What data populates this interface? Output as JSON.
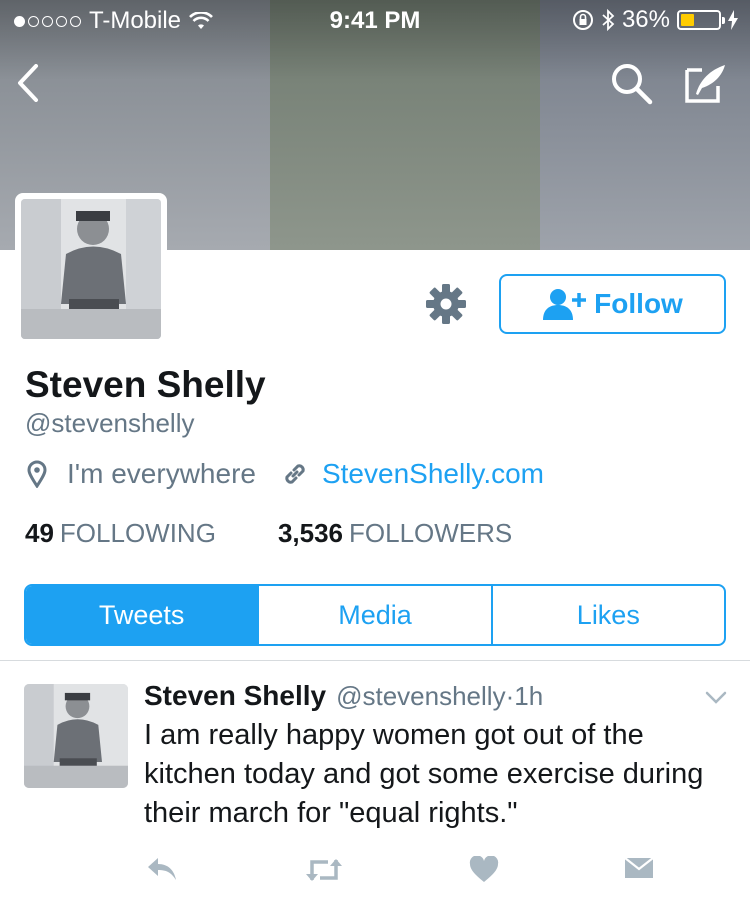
{
  "status_bar": {
    "carrier": "T-Mobile",
    "time": "9:41 PM",
    "battery": "36%",
    "battery_level": 0.36
  },
  "profile": {
    "name": "Steven Shelly",
    "handle": "@stevenshelly",
    "location": "I'm everywhere",
    "url": "StevenShelly.com",
    "following_count": "49",
    "following_label": "FOLLOWING",
    "followers_count": "3,536",
    "followers_label": "FOLLOWERS"
  },
  "actions": {
    "follow_label": "Follow"
  },
  "tabs": [
    {
      "label": "Tweets",
      "active": true
    },
    {
      "label": "Media",
      "active": false
    },
    {
      "label": "Likes",
      "active": false
    }
  ],
  "tweet": {
    "name": "Steven Shelly",
    "handle": "@stevenshelly",
    "separator": "·",
    "time": "1h",
    "text": "I am really happy women got out of the kitchen today and got some exercise during their march for \"equal rights.\""
  },
  "icons": {
    "back": "chevron-left-icon",
    "search": "search-icon",
    "compose": "compose-icon",
    "gear": "gear-icon",
    "add_user": "add-user-icon",
    "location": "location-pin-icon",
    "link": "link-icon",
    "reply": "reply-icon",
    "retweet": "retweet-icon",
    "like": "heart-icon",
    "dm": "envelope-icon",
    "more": "chevron-down-icon"
  },
  "colors": {
    "accent": "#1da1f2",
    "secondary_text": "#657786",
    "action_icons": "#aab8c2",
    "battery_fill": "#ffcc00"
  }
}
